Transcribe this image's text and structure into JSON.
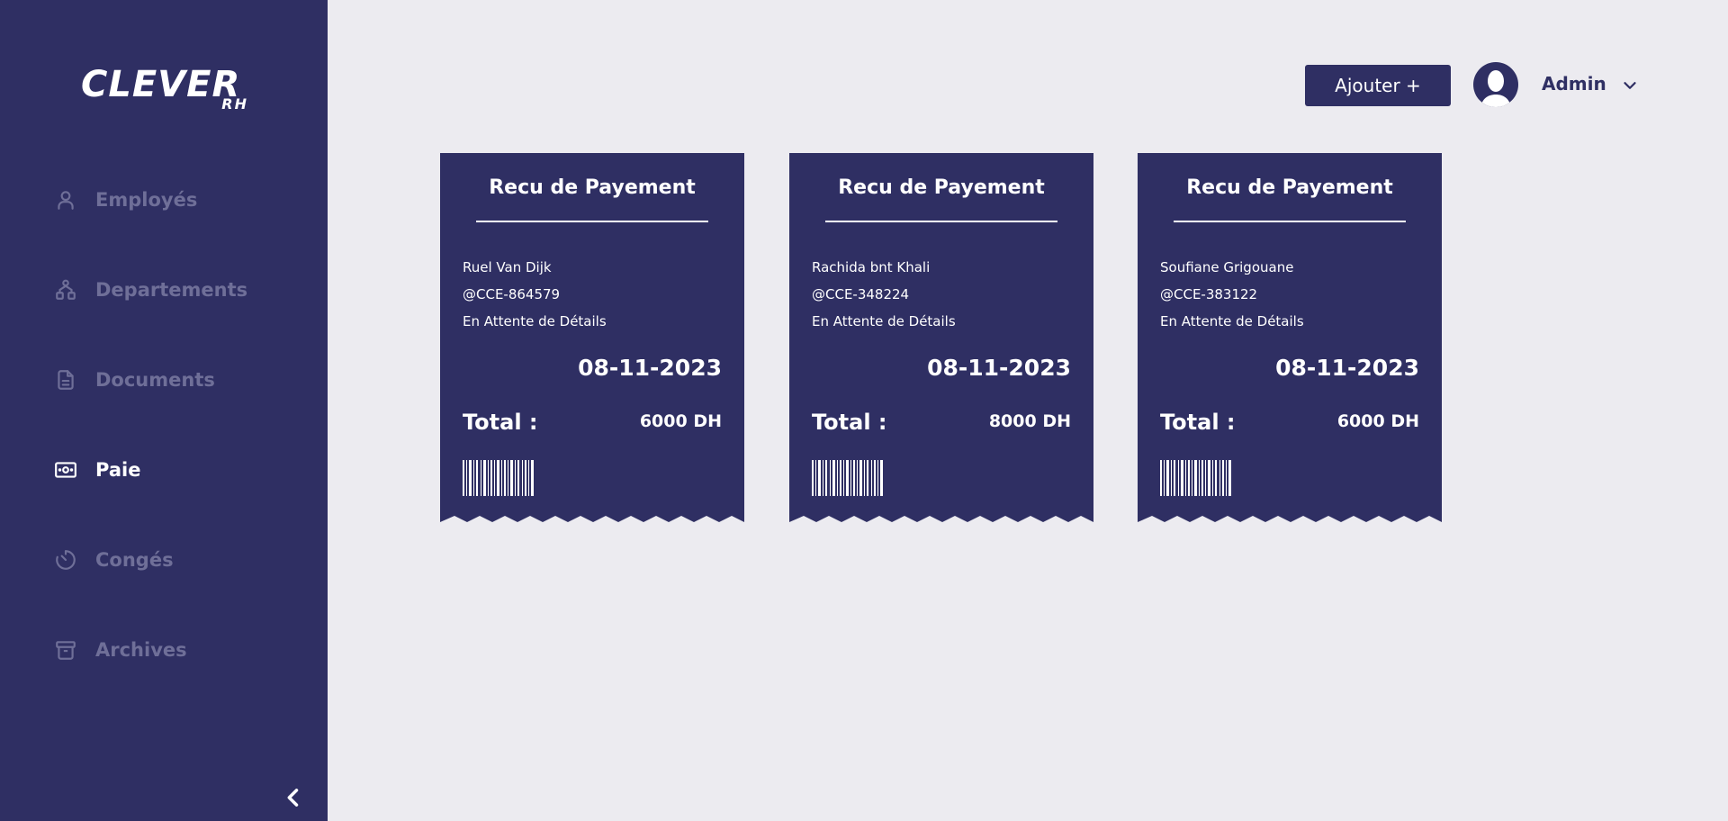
{
  "sidebar": {
    "logo": {
      "main": "CLEVER",
      "sub": "RH"
    },
    "items": [
      {
        "label": "Employés",
        "icon": "user-icon",
        "active": false
      },
      {
        "label": "Departements",
        "icon": "departments-icon",
        "active": false
      },
      {
        "label": "Documents",
        "icon": "document-icon",
        "active": false
      },
      {
        "label": "Paie",
        "icon": "cash-icon",
        "active": true
      },
      {
        "label": "Congés",
        "icon": "timer-icon",
        "active": false
      },
      {
        "label": "Archives",
        "icon": "archive-icon",
        "active": false
      }
    ],
    "collapse_icon": "chevron-left-icon"
  },
  "header": {
    "add_label": "Ajouter +",
    "user_name": "Admin"
  },
  "receipts": [
    {
      "title": "Recu de Payement",
      "name": "Ruel Van Dijk",
      "id": "@CCE-864579",
      "status": "En Attente de Détails",
      "date": "08-11-2023",
      "total_label": "Total :",
      "total_value": "6000 DH"
    },
    {
      "title": "Recu de Payement",
      "name": "Rachida bnt Khali",
      "id": "@CCE-348224",
      "status": "En Attente de Détails",
      "date": "08-11-2023",
      "total_label": "Total :",
      "total_value": "8000 DH"
    },
    {
      "title": "Recu de Payement",
      "name": "Soufiane Grigouane",
      "id": "@CCE-383122",
      "status": "En Attente de Détails",
      "date": "08-11-2023",
      "total_label": "Total :",
      "total_value": "6000 DH"
    }
  ],
  "colors": {
    "primary": "#2F2F63",
    "background": "#ECEBF0",
    "inactive_text": "#6F6F98",
    "white": "#FFFFFF"
  }
}
